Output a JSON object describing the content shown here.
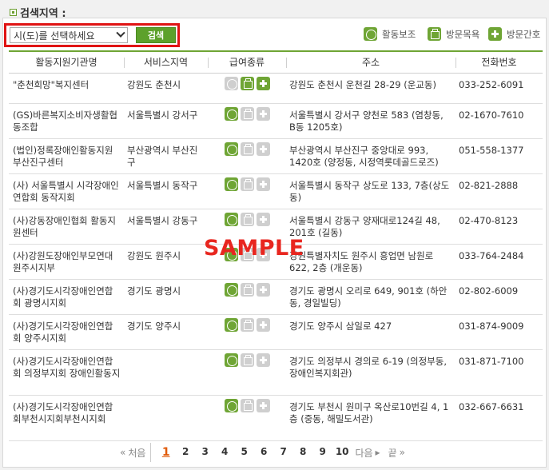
{
  "page_title": "검색지역 :",
  "search": {
    "select_value": "시(도)를 선택하세요",
    "button_label": "검색"
  },
  "legend": [
    {
      "label": "활동보조",
      "icon": "face-icon"
    },
    {
      "label": "방문목욕",
      "icon": "bathtub-icon"
    },
    {
      "label": "방문간호",
      "icon": "plus-icon"
    }
  ],
  "table": {
    "headers": [
      "활동지원기관명",
      "서비스지역",
      "급여종류",
      "주소",
      "전화번호"
    ],
    "rows": [
      {
        "org": "\"춘천희망\"복지센터",
        "region": "강원도 춘천시",
        "services": [
          false,
          true,
          true
        ],
        "address": "강원도 춘천시 운천길 28-29 (운교동)",
        "phone": "033-252-6091"
      },
      {
        "org": "(GS)바른복지소비자생활협동조합",
        "region": "서울특별시 강서구",
        "services": [
          true,
          false,
          false
        ],
        "address": "서울특별시 강서구 양천로 583 (염창동, B동 1205호)",
        "phone": "02-1670-7610"
      },
      {
        "org": "(법인)정록장애인활동지원 부산진구센터",
        "region": "부산광역시 부산진구",
        "services": [
          true,
          false,
          false
        ],
        "address": "부산광역시 부산진구 중앙대로 993, 1420호 (양정동, 시정역롯데골드로즈)",
        "phone": "051-558-1377"
      },
      {
        "org": "(사) 서울특별시 시각장애인연합회 동작지회",
        "region": "서울특별시 동작구",
        "services": [
          true,
          false,
          false
        ],
        "address": "서울특별시 동작구 상도로 133, 7층(상도동)",
        "phone": "02-821-2888"
      },
      {
        "org": "(사)강동장애인협회 활동지원센터",
        "region": "서울특별시 강동구",
        "services": [
          true,
          false,
          false
        ],
        "address": "서울특별시 강동구 양재대로124길 48, 201호 (길동)",
        "phone": "02-470-8123"
      },
      {
        "org": "(사)강원도장애인부모연대 원주시지부",
        "region": "강원도 원주시",
        "services": [
          true,
          false,
          false
        ],
        "address": "강원특별자치도 원주시 흥업면 남원로 622, 2층 (개운동)",
        "phone": "033-764-2484"
      },
      {
        "org": "(사)경기도시각장애인연합회 광명시지회",
        "region": "경기도 광명시",
        "services": [
          true,
          false,
          false
        ],
        "address": "경기도 광명시 오리로 649, 901호 (하안동, 경일빌딩)",
        "phone": "02-802-6009"
      },
      {
        "org": "(사)경기도시각장애인연합회 양주시지회",
        "region": "경기도 양주시",
        "services": [
          true,
          false,
          false
        ],
        "address": "경기도 양주시 삼일로 427",
        "phone": "031-874-9009"
      },
      {
        "org": "(사)경기도시각장애인연합회 의정부지회 장애인활동지",
        "region": "",
        "services": [
          true,
          false,
          false
        ],
        "address": "경기도 의정부시 경의로 6-19 (의정부동, 장애인복지회관)",
        "phone": "031-871-7100"
      },
      {
        "org": "(사)경기도시각장애인연합회부천시지회부천시지회",
        "region": "",
        "services": [
          true,
          false,
          false
        ],
        "address": "경기도 부천시 원미구 옥산로10번길 4, 1층 (중동, 해밀도서관)",
        "phone": "032-667-6631"
      }
    ]
  },
  "watermark": "SAMPLE",
  "pagination": {
    "first_label": "처음",
    "pages": [
      "1",
      "2",
      "3",
      "4",
      "5",
      "6",
      "7",
      "8",
      "9",
      "10"
    ],
    "current": "1",
    "next_label": "다음",
    "last_label": "끝"
  },
  "colors": {
    "accent_green": "#6fa535",
    "highlight_red": "#e01414",
    "active_page": "#e05a0a"
  }
}
